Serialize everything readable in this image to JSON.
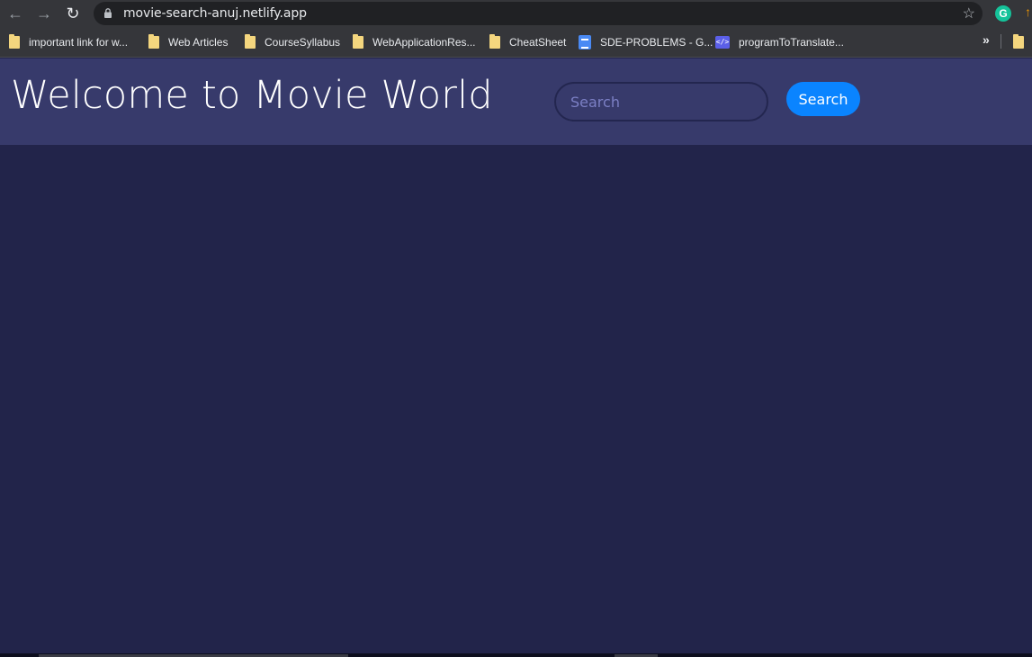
{
  "browser": {
    "url": "movie-search-anuj.netlify.app",
    "back_icon": "back-arrow-icon",
    "forward_icon": "forward-arrow-icon",
    "reload_icon": "reload-icon",
    "extension_grammarly": "G"
  },
  "bookmarks": [
    {
      "label": "important link for w...",
      "icon": "folder-icon"
    },
    {
      "label": "Web Articles",
      "icon": "folder-icon"
    },
    {
      "label": "CourseSyllabus",
      "icon": "folder-icon"
    },
    {
      "label": "WebApplicationRes...",
      "icon": "folder-icon"
    },
    {
      "label": "CheatSheet",
      "icon": "folder-icon"
    },
    {
      "label": "SDE-PROBLEMS - G...",
      "icon": "google-docs-icon"
    },
    {
      "label": "programToTranslate...",
      "icon": "code-icon"
    }
  ],
  "header": {
    "title": "Welcome to Movie World",
    "search_placeholder": "Search",
    "search_button_label": "Search"
  },
  "colors": {
    "header_bg": "#373a6b",
    "page_bg": "#22244a",
    "accent": "#0a84ff"
  }
}
